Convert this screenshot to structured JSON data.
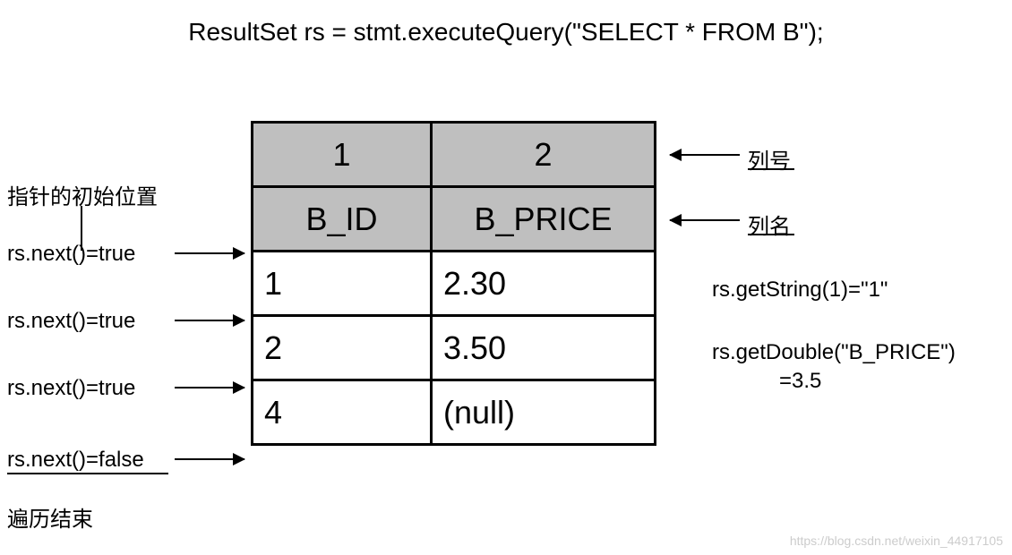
{
  "title": "ResultSet rs = stmt.executeQuery(\"SELECT * FROM B\");",
  "table": {
    "col_index_1": "1",
    "col_index_2": "2",
    "col_name_1": "B_ID",
    "col_name_2": "B_PRICE",
    "rows": [
      {
        "c1": "1",
        "c2": "2.30"
      },
      {
        "c1": "2",
        "c2": "3.50"
      },
      {
        "c1": "4",
        "c2": "(null)"
      }
    ]
  },
  "left_labels": {
    "initial_pos": "指针的初始位置",
    "next1": "rs.next()=true",
    "next2": "rs.next()=true",
    "next3": "rs.next()=true",
    "next4": "rs.next()=false",
    "end": "遍历结束"
  },
  "right_labels": {
    "col_index": "列号",
    "col_name": "列名",
    "get_string": "rs.getString(1)=\"1\"",
    "get_double_1": "rs.getDouble(\"B_PRICE\")",
    "get_double_2": "=3.5"
  },
  "watermark": "https://blog.csdn.net/weixin_44917105",
  "chart_data": {
    "type": "table",
    "title": "ResultSet rs = stmt.executeQuery(\"SELECT * FROM B\");",
    "columns": [
      "B_ID",
      "B_PRICE"
    ],
    "column_indices": [
      1,
      2
    ],
    "rows": [
      [
        "1",
        "2.30"
      ],
      [
        "2",
        "3.50"
      ],
      [
        "4",
        "(null)"
      ]
    ],
    "annotations_left": [
      "指针的初始位置",
      "rs.next()=true",
      "rs.next()=true",
      "rs.next()=true",
      "rs.next()=false",
      "遍历结束"
    ],
    "annotations_right": [
      {
        "label": "列号",
        "points_to": "column index row"
      },
      {
        "label": "列名",
        "points_to": "column name row"
      },
      {
        "label": "rs.getString(1)=\"1\"",
        "points_to": "row 1"
      },
      {
        "label": "rs.getDouble(\"B_PRICE\")=3.5",
        "points_to": "row 2"
      }
    ]
  }
}
